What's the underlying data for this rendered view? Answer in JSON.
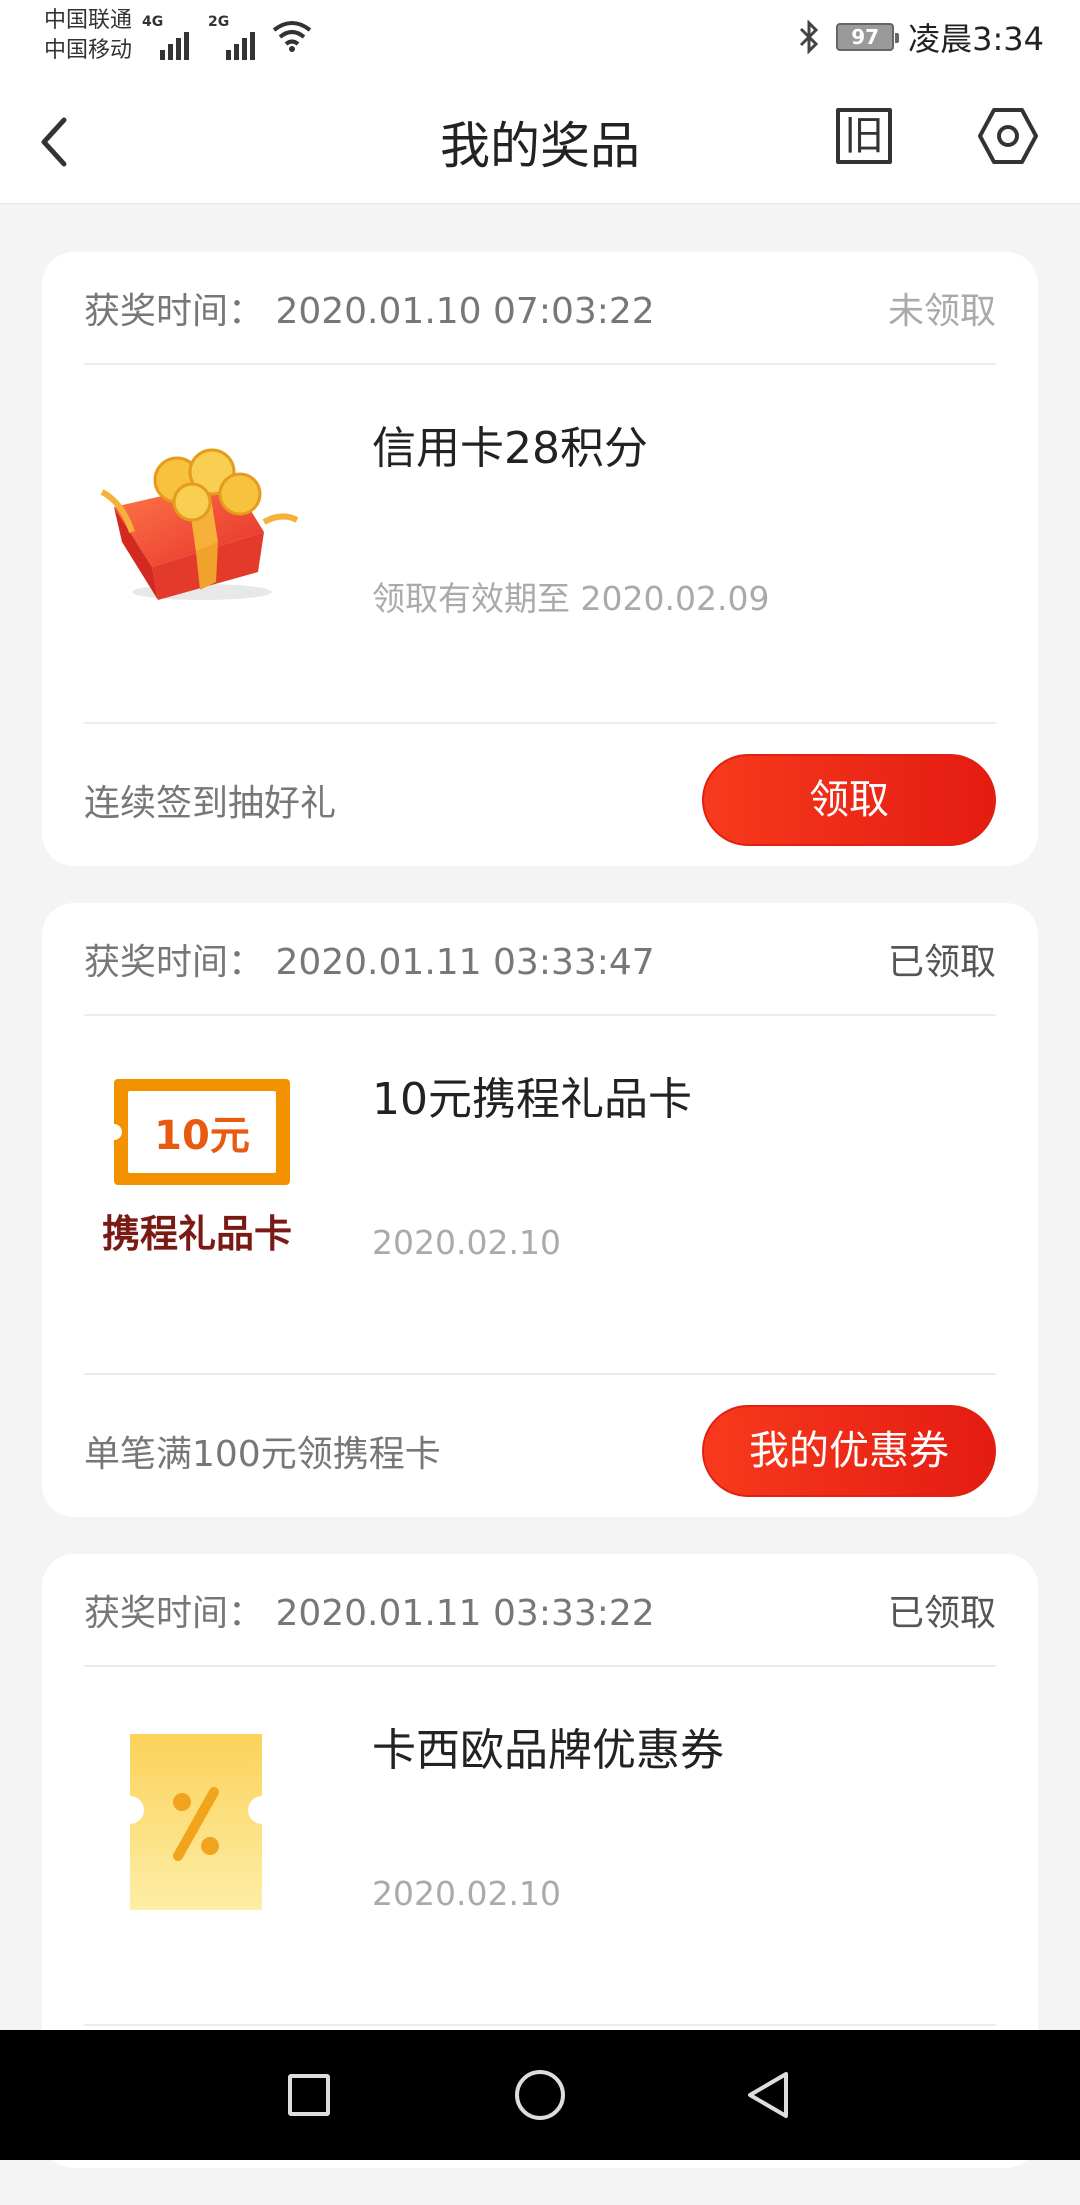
{
  "status_bar": {
    "carrier_1": "中国联通",
    "carrier_2": "中国移动",
    "net_1": "4G",
    "net_2": "2G",
    "battery": "97",
    "time": "凌晨3:34",
    "icons": [
      "signal-icon",
      "signal-icon",
      "wifi-icon",
      "bluetooth-icon",
      "battery-icon"
    ]
  },
  "header": {
    "title": "我的奖品",
    "old_version_label": "旧",
    "icons": [
      "back-icon",
      "settings-icon"
    ]
  },
  "prizes": [
    {
      "award_time": "获奖时间： 2020.01.10 07:03:22",
      "status": "未领取",
      "name": "信用卡28积分",
      "expiry": "领取有效期至 2020.02.09",
      "promo": "连续签到抽好礼",
      "button_label": "领取",
      "thumb_icon": "gift-box-icon"
    },
    {
      "award_time": "获奖时间： 2020.01.11 03:33:47",
      "status": "已领取",
      "name": "10元携程礼品卡",
      "expiry": "2020.02.10",
      "promo": "单笔满100元领携程卡",
      "button_label": "我的优惠券",
      "thumb_icon": "gift-card-icon",
      "thumb_value": "10元",
      "thumb_caption": "携程礼品卡"
    },
    {
      "award_time": "获奖时间： 2020.01.11 03:33:22",
      "status": "已领取",
      "name": "卡西欧品牌优惠券",
      "expiry": "2020.02.10",
      "thumb_icon": "coupon-ticket-icon"
    }
  ],
  "colors": {
    "accent": "#e41b12",
    "background": "#f4f4f4",
    "card": "#ffffff"
  }
}
